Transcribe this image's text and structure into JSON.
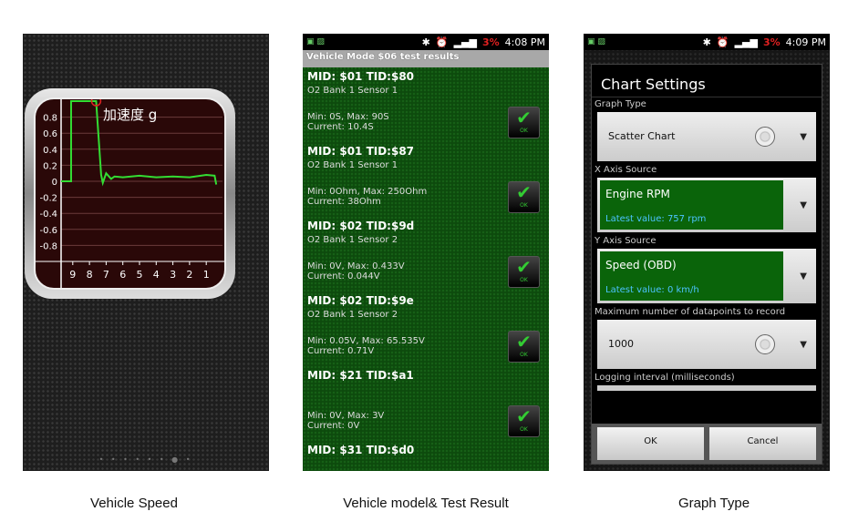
{
  "panels": {
    "vehicle_speed": {
      "caption": "Vehicle Speed",
      "chart_title": "加速度 g",
      "page_indicator": "• • • • • • ●  •"
    },
    "test_results": {
      "caption": "Vehicle model& Test Result",
      "time": "4:08 PM",
      "battery": "3%",
      "title": "Vehicle Mode $06 test results",
      "items": [
        {
          "heading": "MID: $01 TID:$80",
          "sensor": "O2 Bank 1 Sensor 1",
          "range": "Min: 0S, Max: 90S",
          "current": "Current: 10.4S",
          "status": "OK"
        },
        {
          "heading": "MID: $01 TID:$87",
          "sensor": "O2 Bank 1 Sensor 1",
          "range": "Min: 0Ohm, Max: 250Ohm",
          "current": "Current: 38Ohm",
          "status": "OK"
        },
        {
          "heading": "MID: $02 TID:$9d",
          "sensor": "O2 Bank 1 Sensor 2",
          "range": "Min: 0V, Max: 0.433V",
          "current": "Current: 0.044V",
          "status": "OK"
        },
        {
          "heading": "MID: $02 TID:$9e",
          "sensor": "O2 Bank 1 Sensor 2",
          "range": "Min: 0.05V, Max: 65.535V",
          "current": "Current: 0.71V",
          "status": "OK"
        },
        {
          "heading": "MID: $21 TID:$a1",
          "sensor": "",
          "range": "Min: 0V, Max: 3V",
          "current": "Current: 0V",
          "status": "OK"
        },
        {
          "heading": "MID: $31 TID:$d0",
          "sensor": "",
          "range": "",
          "current": "",
          "status": ""
        }
      ]
    },
    "graph_type": {
      "caption": "Graph Type",
      "time": "4:09 PM",
      "battery": "3%",
      "dialog_title": "Chart Settings",
      "graph_type_label": "Graph Type",
      "graph_type_value": "Scatter Chart",
      "x_axis_label": "X Axis Source",
      "x_axis_value": "Engine RPM",
      "x_axis_latest": "Latest value: 757 rpm",
      "y_axis_label": "Y Axis Source",
      "y_axis_value": "Speed (OBD)",
      "y_axis_latest": "Latest value: 0 km/h",
      "max_points_label": "Maximum number of datapoints to record",
      "max_points_value": "1000",
      "logging_label": "Logging interval (milliseconds)",
      "ok": "OK",
      "cancel": "Cancel"
    }
  },
  "chart_data": {
    "type": "line",
    "title": "加速度 g",
    "x_ticks": [
      "9",
      "8",
      "7",
      "6",
      "5",
      "4",
      "3",
      "2",
      "1"
    ],
    "y_ticks": [
      "0.8",
      "0.6",
      "0.4",
      "0.2",
      "0",
      "-0.2",
      "-0.4",
      "-0.6",
      "-0.8"
    ],
    "ylim": [
      -1,
      1
    ],
    "xlim": [
      9.7,
      0.3
    ],
    "x": [
      9.7,
      9.1,
      9.1,
      7.6,
      7.3,
      7.2,
      7.0,
      6.7,
      6.5,
      6.0,
      5.0,
      4.0,
      3.0,
      2.0,
      1.0,
      0.5,
      0.4
    ],
    "y": [
      0,
      0,
      1.0,
      1.0,
      0.08,
      -0.02,
      0.1,
      0.03,
      0.06,
      0.05,
      0.07,
      0.05,
      0.06,
      0.05,
      0.08,
      0.07,
      -0.04
    ],
    "line_color": "#33dd33"
  }
}
